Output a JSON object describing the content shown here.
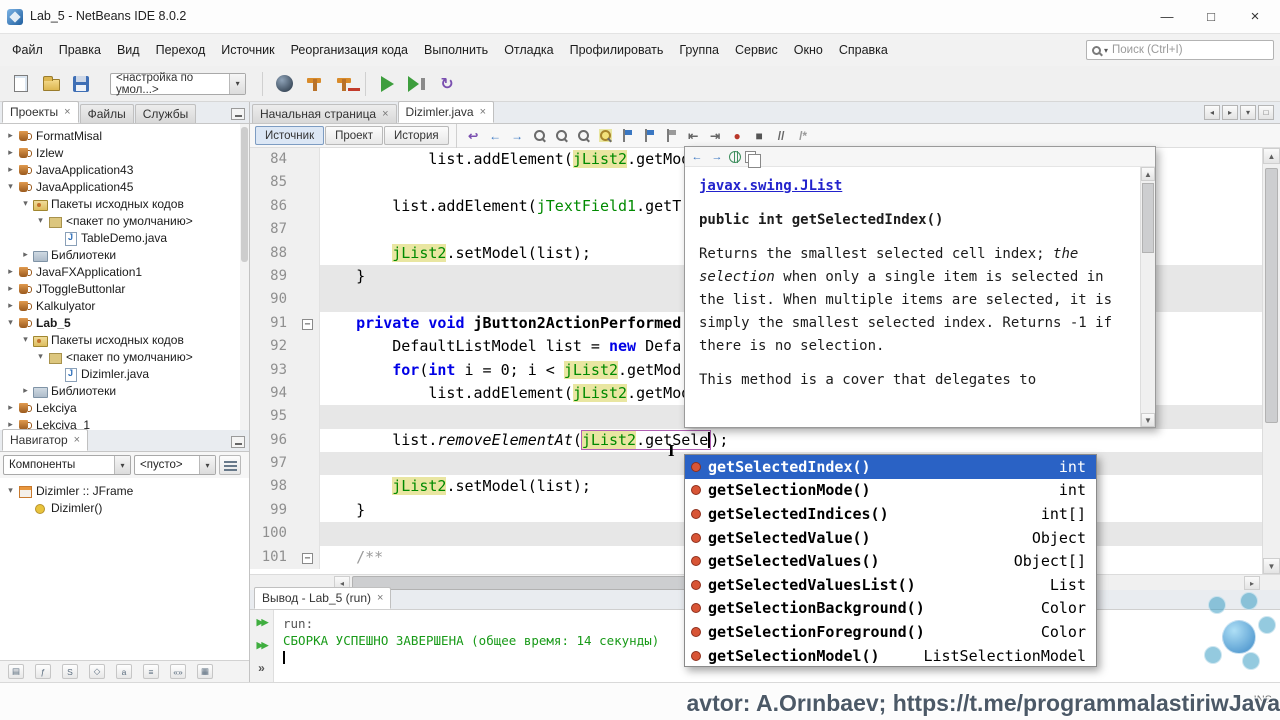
{
  "window": {
    "title": "Lab_5 - NetBeans IDE 8.0.2"
  },
  "window_controls": {
    "minimize": "—",
    "maximize": "□",
    "close": "×"
  },
  "glyphs": {
    "collapsed": "▸",
    "expanded": "▾",
    "dropdown": "▾",
    "close": "×",
    "back": "←",
    "forward": "→",
    "up": "▲",
    "down": "▼",
    "left": "◂",
    "right": "▸",
    "fold": "−",
    "rerun": "▶▶",
    "chevrons": "»",
    "ibeam": "I"
  },
  "menubar": [
    "Файл",
    "Правка",
    "Вид",
    "Переход",
    "Источник",
    "Реорганизация кода",
    "Выполнить",
    "Отладка",
    "Профилировать",
    "Группа",
    "Сервис",
    "Окно",
    "Справка"
  ],
  "search": {
    "placeholder": "Поиск (Ctrl+I)"
  },
  "toolbar": {
    "config_value": "<настройка по умол...>",
    "buttons_left": [
      {
        "name": "new-file-button",
        "icon": "page"
      },
      {
        "name": "open-project-button",
        "icon": "folder"
      },
      {
        "name": "save-all-button",
        "icon": "floppy"
      }
    ],
    "buttons_build": [
      {
        "name": "clean-button",
        "icon": "globe"
      },
      {
        "name": "build-project-button",
        "icon": "hammer"
      },
      {
        "name": "clean-build-button",
        "icon": "hammerbroom"
      }
    ],
    "buttons_run": [
      {
        "name": "run-project-button",
        "icon": "run"
      },
      {
        "name": "debug-project-button",
        "icon": "debug"
      },
      {
        "name": "profile-project-button",
        "icon": "profile"
      }
    ]
  },
  "sidebar": {
    "tabs": [
      {
        "id": "projects",
        "label": "Проекты",
        "active": true
      },
      {
        "id": "files",
        "label": "Файлы"
      },
      {
        "id": "services",
        "label": "Службы"
      }
    ],
    "tree": [
      {
        "label": "FormatMisal",
        "level": 0,
        "icon": "project",
        "arrow": "c"
      },
      {
        "label": "Izlew",
        "level": 0,
        "icon": "project",
        "arrow": "c"
      },
      {
        "label": "JavaApplication43",
        "level": 0,
        "icon": "project",
        "arrow": "c"
      },
      {
        "label": "JavaApplication45",
        "level": 0,
        "icon": "project",
        "arrow": "e"
      },
      {
        "label": "Пакеты исходных кодов",
        "level": 1,
        "icon": "srcpkg",
        "arrow": "e"
      },
      {
        "label": "<пакет по умолчанию>",
        "level": 2,
        "icon": "package",
        "arrow": "e"
      },
      {
        "label": "TableDemo.java",
        "level": 3,
        "icon": "java",
        "arrow": "n"
      },
      {
        "label": "Библиотеки",
        "level": 1,
        "icon": "lib",
        "arrow": "c"
      },
      {
        "label": "JavaFXApplication1",
        "level": 0,
        "icon": "project",
        "arrow": "c"
      },
      {
        "label": "JToggleButtonlar",
        "level": 0,
        "icon": "project",
        "arrow": "c"
      },
      {
        "label": "Kalkulyator",
        "level": 0,
        "icon": "project",
        "arrow": "c"
      },
      {
        "label": "Lab_5",
        "level": 0,
        "icon": "project",
        "arrow": "e",
        "bold": true
      },
      {
        "label": "Пакеты исходных кодов",
        "level": 1,
        "icon": "srcpkg",
        "arrow": "e"
      },
      {
        "label": "<пакет по умолчанию>",
        "level": 2,
        "icon": "package",
        "arrow": "e"
      },
      {
        "label": "Dizimler.java",
        "level": 3,
        "icon": "java",
        "arrow": "n"
      },
      {
        "label": "Библиотеки",
        "level": 1,
        "icon": "lib",
        "arrow": "c"
      },
      {
        "label": "Lekciya",
        "level": 0,
        "icon": "project",
        "arrow": "c"
      },
      {
        "label": "Lekciya_1",
        "level": 0,
        "icon": "project",
        "arrow": "c"
      }
    ]
  },
  "navigator": {
    "title": "Навигатор",
    "combo_value": "Компоненты",
    "filter_value": "<пусто>",
    "tree": [
      {
        "label": "Dizimler :: JFrame",
        "level": 0,
        "icon": "jframe",
        "arrow": "e"
      },
      {
        "label": "Dizimler()",
        "level": 1,
        "icon": "constructor",
        "arrow": "n"
      }
    ],
    "filters": [
      "show-inherited",
      "show-fields",
      "show-static",
      "show-non-public",
      "sort-by-name",
      "sort-by-source",
      "show-fqn",
      "collapse-all"
    ]
  },
  "editor": {
    "tabs": [
      {
        "id": "start-page",
        "label": "Начальная страница"
      },
      {
        "id": "dizimler-java",
        "label": "Dizimler.java",
        "active": true
      }
    ],
    "views": [
      {
        "id": "source",
        "label": "Источник",
        "active": true
      },
      {
        "id": "design",
        "label": "Проект"
      },
      {
        "id": "history",
        "label": "История"
      }
    ],
    "icons": [
      "last-edit",
      "back",
      "forward",
      "find-selection",
      "find-previous",
      "find-next",
      "toggle-highlight",
      "previous-bookmark",
      "next-bookmark",
      "toggle-bookmark",
      "shift-left",
      "shift-right",
      "start-macro",
      "stop-macro",
      "comment",
      "uncomment"
    ],
    "lines": [
      {
        "num": "84",
        "indent": 12,
        "segs": [
          {
            "t": "list.addElement(",
            "c": "p"
          },
          {
            "t": "jList2",
            "c": "f",
            "hl": true
          },
          {
            "t": ".getMod",
            "c": "p"
          }
        ]
      },
      {
        "num": "85",
        "indent": 0,
        "segs": []
      },
      {
        "num": "86",
        "indent": 8,
        "segs": [
          {
            "t": "list.addElement(",
            "c": "p"
          },
          {
            "t": "jTextField1",
            "c": "f"
          },
          {
            "t": ".getT",
            "c": "p"
          }
        ]
      },
      {
        "num": "87",
        "indent": 0,
        "segs": []
      },
      {
        "num": "88",
        "indent": 8,
        "segs": [
          {
            "t": "jList2",
            "c": "f",
            "hl": true
          },
          {
            "t": ".setModel(list);",
            "c": "p"
          }
        ]
      },
      {
        "num": "89",
        "indent": 4,
        "gray": true,
        "segs": [
          {
            "t": "}",
            "c": "p"
          }
        ]
      },
      {
        "num": "90",
        "indent": 0,
        "gray": true,
        "segs": []
      },
      {
        "num": "91",
        "indent": 4,
        "fold": true,
        "segs": [
          {
            "t": "private",
            "c": "k"
          },
          {
            "t": " ",
            "c": "p"
          },
          {
            "t": "void",
            "c": "k"
          },
          {
            "t": " ",
            "c": "p"
          },
          {
            "t": "jButton2ActionPerformed",
            "c": "p",
            "b": true
          }
        ]
      },
      {
        "num": "92",
        "indent": 8,
        "segs": [
          {
            "t": "DefaultListModel list = ",
            "c": "p"
          },
          {
            "t": "new",
            "c": "k"
          },
          {
            "t": " Defa",
            "c": "p"
          }
        ]
      },
      {
        "num": "93",
        "indent": 8,
        "segs": [
          {
            "t": "for",
            "c": "k"
          },
          {
            "t": "(",
            "c": "p"
          },
          {
            "t": "int",
            "c": "k"
          },
          {
            "t": " i = 0; i < ",
            "c": "p"
          },
          {
            "t": "jList2",
            "c": "f",
            "hl": true
          },
          {
            "t": ".getMod",
            "c": "p"
          }
        ]
      },
      {
        "num": "94",
        "indent": 12,
        "segs": [
          {
            "t": "list.addElement(",
            "c": "p"
          },
          {
            "t": "jList2",
            "c": "f",
            "hl": true
          },
          {
            "t": ".getMod",
            "c": "p"
          }
        ]
      },
      {
        "num": "95",
        "indent": 0,
        "gray": true,
        "segs": []
      },
      {
        "num": "96",
        "indent": 8,
        "segs": [
          {
            "t": "list.",
            "c": "p"
          },
          {
            "t": "removeElementAt",
            "c": "p",
            "it": true
          },
          {
            "t": "(",
            "c": "p"
          },
          {
            "t": "jList2",
            "c": "f",
            "hl": true,
            "box": true
          },
          {
            "t": ".getSele",
            "c": "p",
            "box": true,
            "caret": true
          },
          {
            "t": ");",
            "c": "p"
          }
        ]
      },
      {
        "num": "97",
        "indent": 0,
        "gray": true,
        "segs": []
      },
      {
        "num": "98",
        "indent": 8,
        "segs": [
          {
            "t": "jList2",
            "c": "f",
            "hl": true
          },
          {
            "t": ".setModel(list);",
            "c": "p"
          }
        ]
      },
      {
        "num": "99",
        "indent": 4,
        "segs": [
          {
            "t": "}",
            "c": "p"
          }
        ]
      },
      {
        "num": "100",
        "indent": 0,
        "gray": true,
        "segs": []
      },
      {
        "num": "101",
        "indent": 4,
        "fold": true,
        "segs": [
          {
            "t": "/**",
            "c": "c"
          }
        ]
      }
    ]
  },
  "javadoc": {
    "link": "javax.swing.JList",
    "signature": "public int getSelectedIndex()",
    "body_pre": "Returns the smallest selected cell index; ",
    "body_em": "the selection",
    "body_post": " when only a single item is selected in the list. When multiple items are selected, it is simply the smallest selected index. Returns -1 if there is no selection.",
    "footer": "This method is a cover that delegates to"
  },
  "completion": {
    "items": [
      {
        "name": "getSelectedIndex()",
        "type": "int",
        "selected": true
      },
      {
        "name": "getSelectionMode()",
        "type": "int"
      },
      {
        "name": "getSelectedIndices()",
        "type": "int[]"
      },
      {
        "name": "getSelectedValue()",
        "type": "Object"
      },
      {
        "name": "getSelectedValues()",
        "type": "Object[]"
      },
      {
        "name": "getSelectedValuesList()",
        "type": "List"
      },
      {
        "name": "getSelectionBackground()",
        "type": "Color"
      },
      {
        "name": "getSelectionForeground()",
        "type": "Color"
      },
      {
        "name": "getSelectionModel()",
        "type": "ListSelectionModel"
      }
    ]
  },
  "output": {
    "tab": "Вывод - Lab_5 (run)",
    "lines": [
      {
        "text": "run:",
        "type": "plain"
      },
      {
        "text": "СБОРКА УСПЕШНО ЗАВЕРШЕНА (общее время: 14 секунды)",
        "type": "success"
      }
    ]
  },
  "statusbar": {
    "insert_mode": "INS"
  },
  "watermark": "avtor: A.Orınbaev; https://t.me/programmalastiriwJava"
}
